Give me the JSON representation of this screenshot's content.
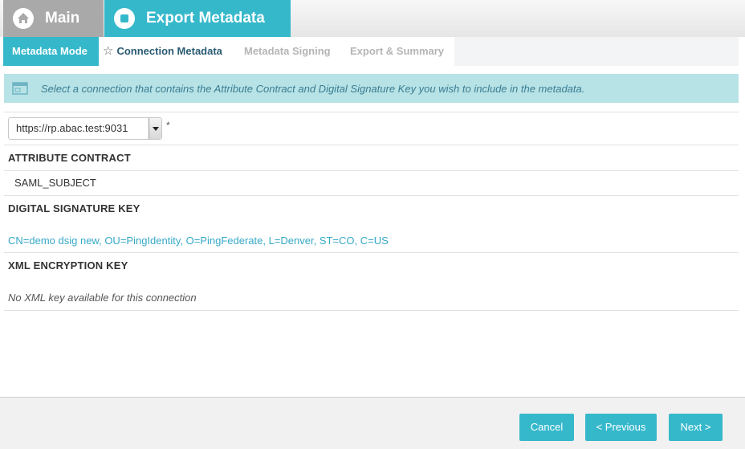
{
  "header": {
    "main_label": "Main",
    "export_label": "Export Metadata"
  },
  "steps": {
    "mode": "Metadata Mode",
    "connection": "Connection Metadata",
    "signing": "Metadata Signing",
    "summary": "Export & Summary"
  },
  "banner": {
    "text": "Select a connection that contains the Attribute Contract and Digital Signature Key you wish to include in the metadata."
  },
  "connection_select": {
    "value": "https://rp.abac.test:9031",
    "required_marker": "*"
  },
  "attribute_contract": {
    "label": "ATTRIBUTE CONTRACT",
    "value": "SAML_SUBJECT"
  },
  "digital_signature": {
    "label": "DIGITAL SIGNATURE KEY",
    "value": "CN=demo dsig new, OU=PingIdentity, O=PingFederate, L=Denver, ST=CO, C=US"
  },
  "xml_encryption": {
    "label": "XML ENCRYPTION KEY",
    "value": "No XML key available for this connection"
  },
  "footer": {
    "cancel": "Cancel",
    "previous": "< Previous",
    "next": "Next >"
  },
  "colors": {
    "accent": "#36b8cb",
    "banner_bg": "#b7e3e6",
    "link": "#36a9c7",
    "inactive_tab": "#a9a9a9"
  },
  "icons": {
    "main": "home-icon",
    "export": "stop-icon",
    "step_current": "star-icon",
    "banner": "info-panel-icon",
    "select": "dropdown-arrow-icon"
  }
}
